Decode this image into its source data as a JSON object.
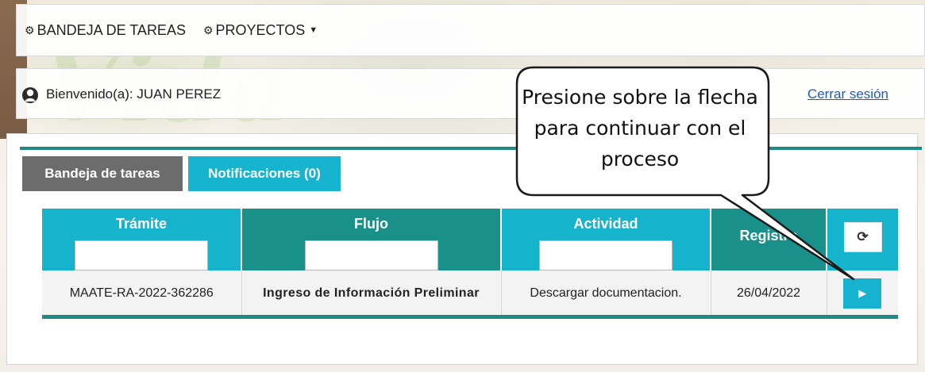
{
  "nav": {
    "items": [
      {
        "label": "BANDEJA DE TAREAS",
        "icon": "gear-icon"
      },
      {
        "label": "PROYECTOS",
        "icon": "gear-icon",
        "dropdown": true
      }
    ]
  },
  "welcome": {
    "text": "Bienvenido(a): JUAN PEREZ",
    "logout_label": "Cerrar sesión"
  },
  "tabs": [
    {
      "label": "Bandeja de tareas",
      "active": false,
      "color": "#6c6c6c"
    },
    {
      "label": "Notificaciones (0)",
      "active": true,
      "color": "#17b4cf"
    }
  ],
  "table": {
    "columns": [
      {
        "label": "Trámite",
        "filter": true,
        "color": "#16b3cc"
      },
      {
        "label": "Flujo",
        "filter": true,
        "color": "#19918a"
      },
      {
        "label": "Actividad",
        "filter": true,
        "color": "#16b3cc"
      },
      {
        "label": "Registro",
        "filter": false,
        "color": "#19918a"
      }
    ],
    "refresh_icon": "refresh-icon",
    "rows": [
      {
        "tramite": "MAATE-RA-2022-362286",
        "flujo": "Ingreso de Información Preliminar",
        "actividad": "Descargar documentacion.",
        "registro": "26/04/2022",
        "action_icon": "play-icon"
      }
    ]
  },
  "callout": {
    "text": "Presione sobre la flecha para continuar con el proceso"
  },
  "colors": {
    "accent_cyan": "#17b4cf",
    "accent_teal": "#1f8a84",
    "link": "#1e5bc6"
  }
}
